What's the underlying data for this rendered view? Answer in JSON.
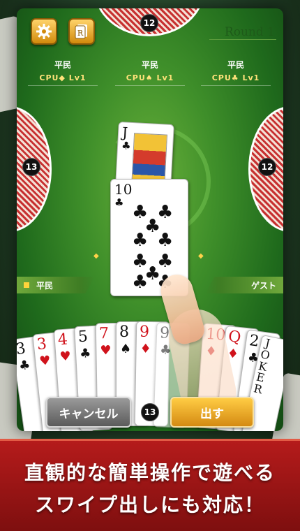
{
  "hud": {
    "round_label": "Round 1",
    "top_opponent_count": "12",
    "left_opponent_count": "13",
    "right_opponent_count": "12",
    "player_card_count": "13"
  },
  "opponents": [
    {
      "rank": "平民",
      "name": "CPU◆ Lv1"
    },
    {
      "rank": "平民",
      "name": "CPU♠ Lv1"
    },
    {
      "rank": "平民",
      "name": "CPU♣ Lv1"
    }
  ],
  "labels": {
    "player_rank": "平民",
    "guest": "ゲスト"
  },
  "table_cards": [
    {
      "rank": "J",
      "suit": "♣"
    },
    {
      "rank": "10",
      "suit": "♣"
    }
  ],
  "hand": [
    {
      "rank": "3",
      "suit": "♣",
      "color": "#111111"
    },
    {
      "rank": "3",
      "suit": "♥",
      "color": "#d0121b"
    },
    {
      "rank": "4",
      "suit": "♥",
      "color": "#d0121b"
    },
    {
      "rank": "5",
      "suit": "♣",
      "color": "#111111"
    },
    {
      "rank": "7",
      "suit": "♥",
      "color": "#d0121b"
    },
    {
      "rank": "8",
      "suit": "♠",
      "color": "#111111"
    },
    {
      "rank": "9",
      "suit": "♦",
      "color": "#d0121b"
    },
    {
      "rank": "9",
      "suit": "♣",
      "color": "#111111"
    },
    {
      "rank": "10",
      "suit": "♦",
      "color": "#d0121b"
    },
    {
      "rank": "Q",
      "suit": "♦",
      "color": "#d0121b"
    },
    {
      "rank": "2",
      "suit": "♣",
      "color": "#111111"
    }
  ],
  "joker_text": "JOKER",
  "buttons": {
    "cancel": "キャンセル",
    "play": "出す"
  },
  "banner": {
    "line1": "直観的な簡単操作で遊べる",
    "line2": "スワイプ出しにも対応！"
  },
  "icons": {
    "settings": "gear-icon",
    "rules": "rule-book-icon"
  },
  "colors": {
    "felt": "#3f8f2a",
    "accent_gold": "#d18a0c",
    "banner_red": "#b51b1b"
  }
}
